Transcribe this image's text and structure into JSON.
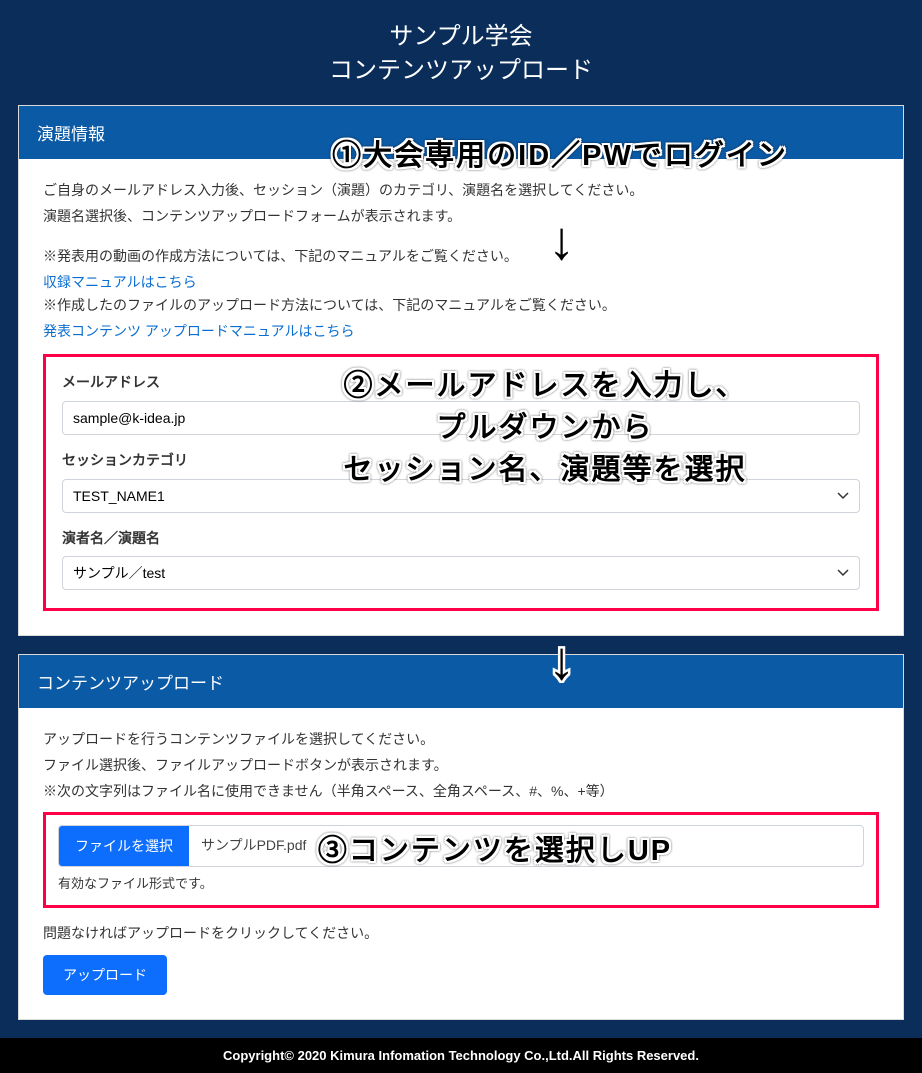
{
  "header": {
    "line1": "サンプル学会",
    "line2": "コンテンツアップロード"
  },
  "panel1": {
    "title": "演題情報",
    "desc1": "ご自身のメールアドレス入力後、セッション（演題）のカテゴリ、演題名を選択してください。",
    "desc2": "演題名選択後、コンテンツアップロードフォームが表示されます。",
    "note1": "※発表用の動画の作成方法については、下記のマニュアルをご覧ください。",
    "link1": "収録マニュアルはこちら",
    "note2": "※作成したのファイルのアップロード方法については、下記のマニュアルをご覧ください。",
    "link2": "発表コンテンツ アップロードマニュアルはこちら",
    "fields": {
      "email_label": "メールアドレス",
      "email_value": "sample@k-idea.jp",
      "category_label": "セッションカテゴリ",
      "category_value": "TEST_NAME1",
      "title_label": "演者名／演題名",
      "title_value": "サンプル／test"
    }
  },
  "panel2": {
    "title": "コンテンツアップロード",
    "desc1": "アップロードを行うコンテンツファイルを選択してください。",
    "desc2": "ファイル選択後、ファイルアップロードボタンが表示されます。",
    "desc3": "※次の文字列はファイル名に使用できません（半角スペース、全角スペース、#、%、+等）",
    "file_button": "ファイルを選択",
    "file_name": "サンプルPDF.pdf",
    "file_valid": "有効なファイル形式です。",
    "upload_note": "問題なければアップロードをクリックしてください。",
    "upload_button": "アップロード"
  },
  "footer": "Copyright© 2020 Kimura Infomation Technology Co.,Ltd.All Rights Reserved.",
  "annotations": {
    "a1": "①大会専用のID／PWでログイン",
    "a2_l1": "②メールアドレスを入力し、",
    "a2_l2": "プルダウンから",
    "a2_l3": "セッション名、演題等を選択",
    "a3": "③コンテンツを選択しUP",
    "arrow": "↓"
  }
}
